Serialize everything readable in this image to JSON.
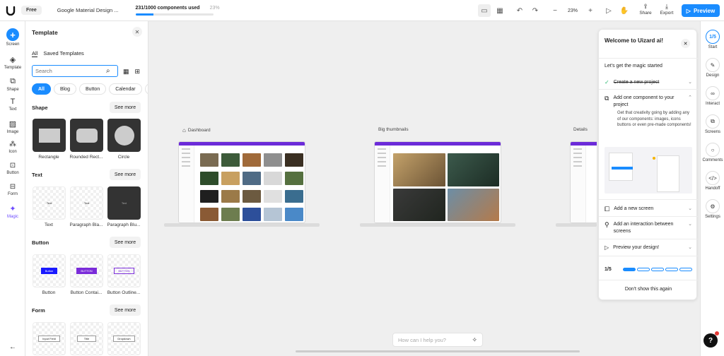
{
  "topbar": {
    "plan": "Free",
    "project_name": "Google Material Design ...",
    "usage_label": "231/1000 components used",
    "usage_percent": "23%",
    "usage_fraction": 0.231,
    "zoom": "23%",
    "share": "Share",
    "export": "Export",
    "preview": "Preview"
  },
  "left_rail": {
    "items": [
      {
        "label": "Screen",
        "icon": "plus-icon"
      },
      {
        "label": "Template",
        "icon": "layers-icon"
      },
      {
        "label": "Shape",
        "icon": "shapes-icon"
      },
      {
        "label": "Text",
        "icon": "text-icon"
      },
      {
        "label": "Image",
        "icon": "image-icon"
      },
      {
        "label": "Icon",
        "icon": "icon-grid-icon"
      },
      {
        "label": "Button",
        "icon": "button-icon"
      },
      {
        "label": "Form",
        "icon": "form-icon"
      },
      {
        "label": "Magic",
        "icon": "magic-icon"
      }
    ]
  },
  "panel": {
    "title": "Template",
    "tabs": [
      "All",
      "Saved Templates"
    ],
    "search_placeholder": "Search",
    "chips": [
      "All",
      "Blog",
      "Button",
      "Calendar",
      "C"
    ],
    "see_more": "See more",
    "sections": [
      {
        "title": "Shape",
        "items": [
          "Rectangle",
          "Rounded Rect...",
          "Circle"
        ]
      },
      {
        "title": "Text",
        "items": [
          "Text",
          "Paragraph Bla...",
          "Paragraph Blu..."
        ],
        "samples": [
          "Text",
          "Text",
          "Text"
        ]
      },
      {
        "title": "Button",
        "items": [
          "Button",
          "Button Contai...",
          "Button Outline..."
        ],
        "samples": [
          "Button",
          "BUTTON",
          "BUTTON"
        ]
      },
      {
        "title": "Form",
        "items": [],
        "samples": [
          "Input Field",
          "Title",
          "Dropdown"
        ]
      }
    ]
  },
  "canvas": {
    "frames": [
      "Dashboard",
      "Big thumbnails",
      "Details"
    ],
    "ask_placeholder": "How can I help you?"
  },
  "welcome": {
    "title": "Welcome to Uizard ai!",
    "subtitle": "Let's get the magic started",
    "steps": [
      {
        "label": "Create a new project",
        "done": true
      },
      {
        "label": "Add one component to your project",
        "done": false
      },
      {
        "label": "Add a new screen",
        "done": false
      },
      {
        "label": "Add an interaction between screens",
        "done": false
      },
      {
        "label": "Preview your design!",
        "done": false
      }
    ],
    "step_desc": "Get that creativity going by adding any of our components: images, icons buttons or even pre-made components!",
    "progress_label": "1/5",
    "progress_done": 1,
    "progress_total": 5,
    "dont_show": "Don't show this again"
  },
  "right_rail": {
    "items": [
      {
        "label": "Start",
        "badge": "1/5"
      },
      {
        "label": "Design",
        "icon": "pencil-icon"
      },
      {
        "label": "Interact",
        "icon": "link-icon"
      },
      {
        "label": "Screens",
        "icon": "screens-icon"
      },
      {
        "label": "Comments",
        "icon": "comment-icon"
      },
      {
        "label": "Handoff",
        "icon": "code-icon"
      },
      {
        "label": "Settings",
        "icon": "gear-icon"
      }
    ]
  },
  "help": "?",
  "colors": {
    "accent": "#1a8cff",
    "brand_purple": "#6c2bd9",
    "check_green": "#2eb872"
  }
}
